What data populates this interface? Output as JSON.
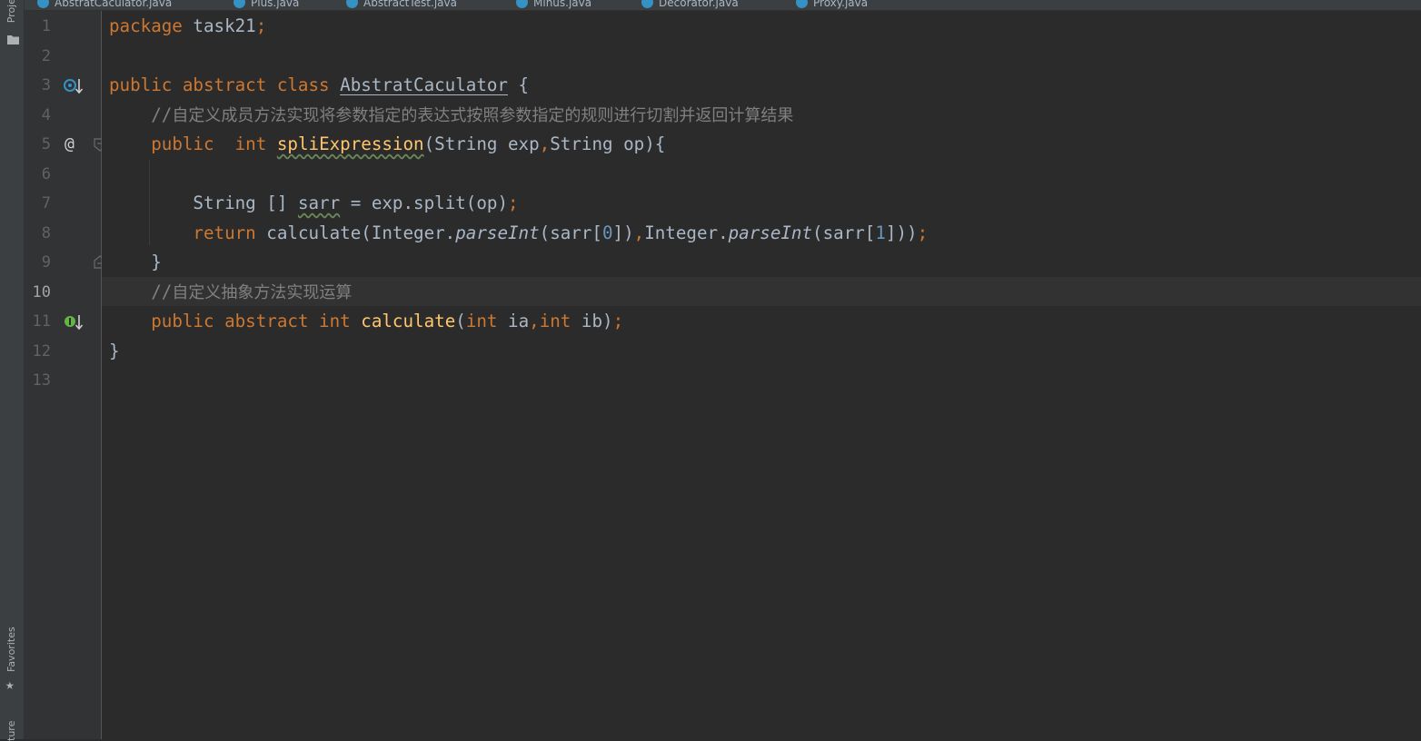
{
  "left_toolbar": {
    "project_label": "Proje",
    "favorites_label": "Favorites",
    "structure_label": "ture",
    "icons": [
      "folder-icon",
      "star-icon"
    ]
  },
  "editor_tabs": [
    {
      "label": "AbstratCaculator.java",
      "active": true
    },
    {
      "label": "Plus.java",
      "active": false
    },
    {
      "label": "AbstractTest.java",
      "active": false
    },
    {
      "label": "Minus.java",
      "active": false
    },
    {
      "label": "Decorator.java",
      "active": false
    },
    {
      "label": "Proxy.java",
      "active": false
    }
  ],
  "gutter": {
    "line_numbers": [
      "1",
      "2",
      "3",
      "4",
      "5",
      "6",
      "7",
      "8",
      "9",
      "10",
      "11",
      "12",
      "13"
    ],
    "current_line": "10",
    "markers": {
      "line3": "implemented-icon",
      "line5": "@",
      "line5_fold": "fold-icon",
      "line9_fold": "fold-end-icon",
      "line11": "implemented-method-icon"
    }
  },
  "code": {
    "l1": {
      "kw_package": "package",
      "pkg": " task21",
      "semi": ";"
    },
    "l3": {
      "kw_public": "public",
      "kw_abstract": " abstract",
      "kw_class": " class",
      "sp": " ",
      "class_name": "AbstratCaculator",
      "brace": " {"
    },
    "l4": {
      "slashes": "//",
      "comment": "自定义成员方法实现将参数指定的表达式按照参数指定的规则进行切割并返回计算结果"
    },
    "l5": {
      "kw_public": "public",
      "kw_int": "  int",
      "sp": " ",
      "method": "spliExpression",
      "params_a": "(String exp",
      "comma": ",",
      "params_b": "String op){"
    },
    "l7": {
      "a": "String [] ",
      "var": "sarr",
      "b": " = exp.split(op)",
      "semi": ";"
    },
    "l8": {
      "kw_return": "return",
      "a": " calculate(Integer.",
      "m1": "parseInt",
      "b": "(sarr[",
      "n0": "0",
      "c": "])",
      "comma": ",",
      "d": "Integer.",
      "m2": "parseInt",
      "e": "(sarr[",
      "n1": "1",
      "f": "]))",
      "semi": ";"
    },
    "l9": {
      "brace": "}"
    },
    "l10": {
      "slashes": "//",
      "comment": "自定义抽象方法实现运算"
    },
    "l11": {
      "kw_public": "public",
      "kw_abstract": " abstract",
      "kw_int": " int",
      "sp": " ",
      "method": "calculate",
      "p_open": "(",
      "kw_int2": "int",
      "p_a": " ia",
      "comma": ",",
      "kw_int3": "int",
      "p_b": " ib)",
      "semi": ";"
    },
    "l12": {
      "brace": "}"
    }
  },
  "colors": {
    "background": "#2b2b2b",
    "keyword": "#cc7832",
    "method": "#ffc66d",
    "number": "#6897bb",
    "comment": "#808080",
    "text": "#a9b7c6"
  }
}
